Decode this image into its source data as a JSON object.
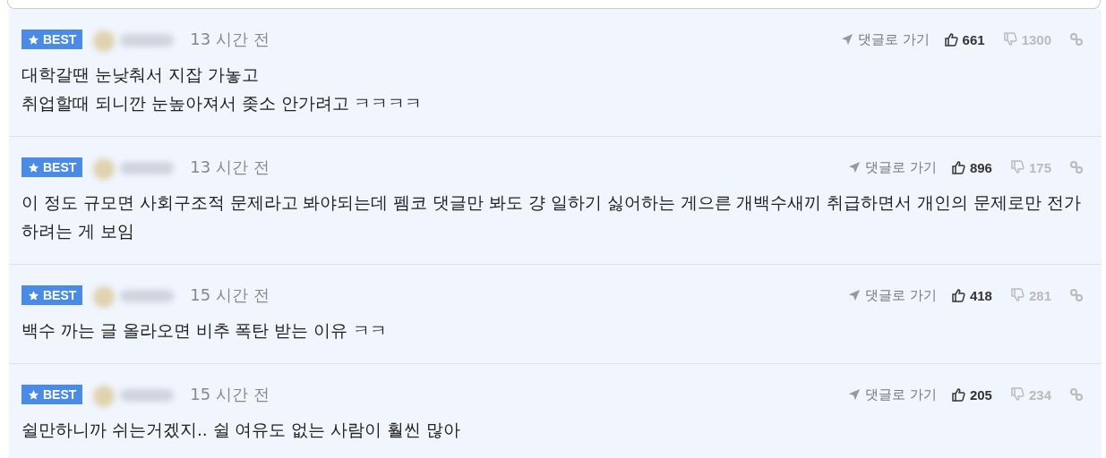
{
  "comments": [
    {
      "badge": "BEST",
      "time": "13 시간 전",
      "goto": "댓글로 가기",
      "likes": "661",
      "dislikes": "1300",
      "text": "대학갈땐 눈낮춰서 지잡 가놓고\n취업할때 되니깐 눈높아져서 좆소 안가려고 ㅋㅋㅋㅋ"
    },
    {
      "badge": "BEST",
      "time": "13 시간 전",
      "goto": "댓글로 가기",
      "likes": "896",
      "dislikes": "175",
      "text": "이 정도 규모면 사회구조적 문제라고 봐야되는데 펨코 댓글만 봐도 걍 일하기 싫어하는 게으른 개백수새끼 취급하면서 개인의 문제로만 전가하려는 게 보임"
    },
    {
      "badge": "BEST",
      "time": "15 시간 전",
      "goto": "댓글로 가기",
      "likes": "418",
      "dislikes": "281",
      "text": "백수 까는 글 올라오면 비추 폭탄 받는 이유 ㅋㅋ"
    },
    {
      "badge": "BEST",
      "time": "15 시간 전",
      "goto": "댓글로 가기",
      "likes": "205",
      "dislikes": "234",
      "text": "쉴만하니까 쉬는거겠지.. 쉴 여유도 없는 사람이 훨씬 많아"
    }
  ]
}
